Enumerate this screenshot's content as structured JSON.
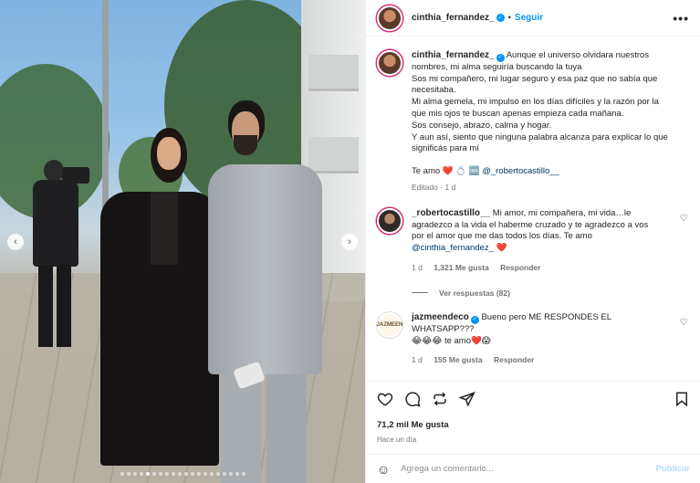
{
  "header": {
    "username": "cinthia_fernandez_",
    "separator": "•",
    "follow_label": "Seguir",
    "more_glyph": "•••"
  },
  "caption": {
    "username": "cinthia_fernandez_",
    "lines": [
      "Aunque el universo olvidara nuestros",
      "nombres, mi alma seguiría buscando la tuya",
      "Sos mi compañero, mi lugar seguro y esa paz que no sabía que",
      "necesitaba.",
      "Mi alma gemela, mi impulso en los días difíciles y la razón por la",
      "que mis ojos te buscan apenas empieza cada mañana.",
      "Sos consejo, abrazo, calma y hogar.",
      "Y aun así, siento que ninguna palabra alcanza para explicar lo que",
      "significás para mí"
    ],
    "signoff": "Te amo",
    "signoff_emojis": "❤️ 💍 🆒",
    "mention": "@_robertocastillo__",
    "edited": "Editado",
    "edited_sep": "·",
    "edited_time": "1 d"
  },
  "comments": [
    {
      "username": "_robertocastillo__",
      "lines": [
        "Mi amor, mi compañera, mi vida…le",
        "agradezco a la vida el haberme cruzado y te agradezco a vos",
        "por el amor que me das todos los días. Te amo"
      ],
      "mention": "@cinthia_fernandez_",
      "trailing_emoji": "❤️",
      "time": "1 d",
      "likes": "1,321 Me gusta",
      "reply": "Responder",
      "view_replies": "Ver respuestas (82)"
    },
    {
      "username": "jazmeendeco",
      "avatar_text": "JAZMEEN",
      "text": "Bueno pero ME RESPONDES EL WHATSAPP???",
      "line2": "😂😂😂 te amo❤️😱",
      "time": "1 d",
      "likes": "155 Me gusta",
      "reply": "Responder"
    }
  ],
  "actions": {
    "likes": "71,2 mil Me gusta",
    "ago": "Hace un día"
  },
  "add_comment": {
    "placeholder": "Agrega un comentario...",
    "publish": "Publicar"
  },
  "colors": {
    "link_blue": "#0095f6",
    "mention_blue": "#00376b",
    "like_red": "#ed4956",
    "muted": "#737373"
  }
}
